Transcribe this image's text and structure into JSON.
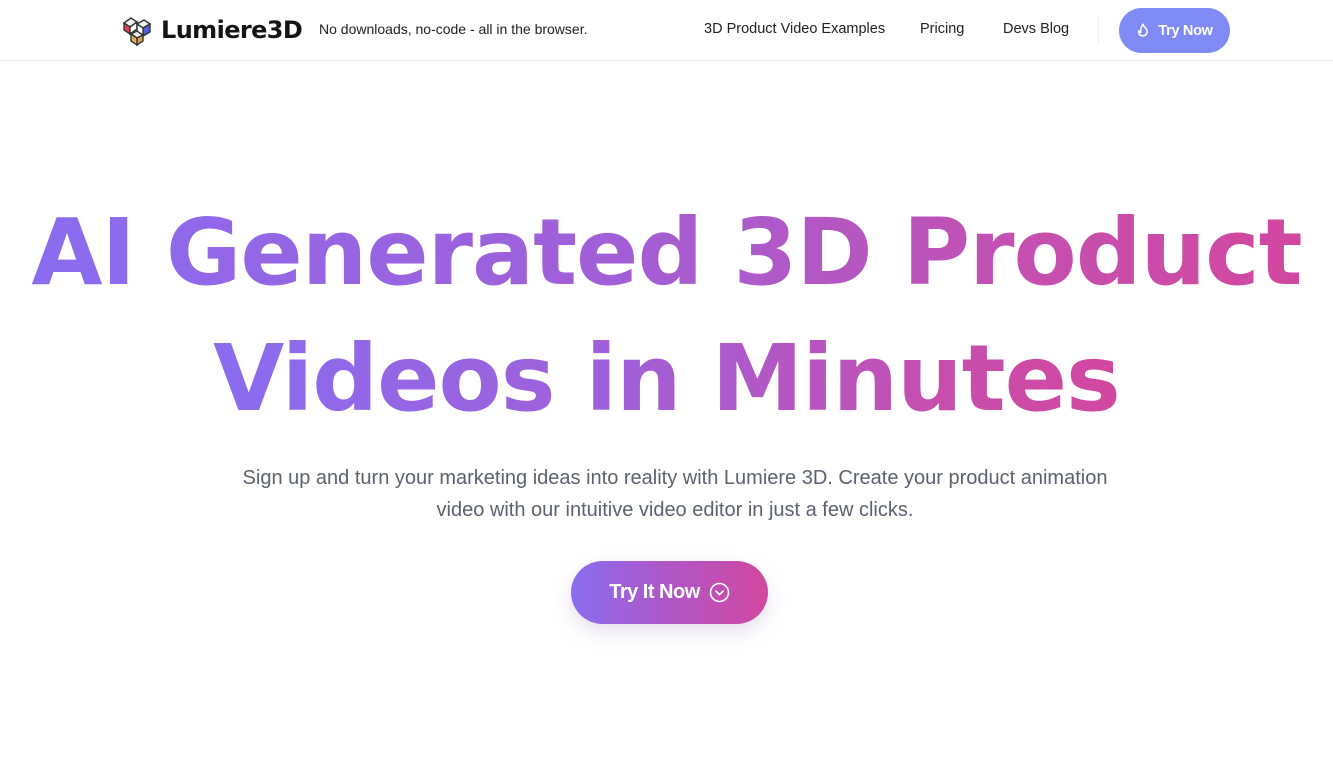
{
  "header": {
    "brand": "Lumiere3D",
    "tagline": "No downloads, no-code - all in the browser.",
    "nav": [
      {
        "label": "3D Product Video Examples"
      },
      {
        "label": "Pricing"
      },
      {
        "label": "Devs Blog"
      }
    ],
    "cta": {
      "label": "Try Now",
      "icon": "flame-icon",
      "color": "#7f8af4"
    }
  },
  "hero": {
    "title_line1": "AI Generated 3D Product",
    "title_line2": "Videos in Minutes",
    "gradient": {
      "start": "#8a6cf0",
      "end": "#d2479f"
    },
    "subtitle_line1": "Sign up and turn your marketing ideas into reality with Lumiere 3D. Create your product animation",
    "subtitle_line2": "video with our intuitive video editor in just a few clicks.",
    "cta": {
      "label": "Try It Now",
      "icon": "chevron-down-circle-icon"
    }
  }
}
